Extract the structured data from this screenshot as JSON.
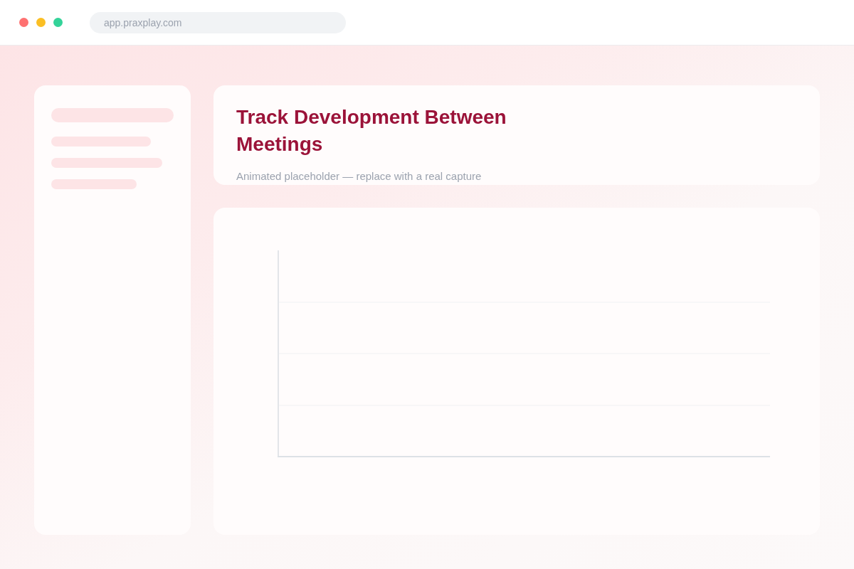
{
  "browser_bar": {
    "url": "app.praxplay.com"
  },
  "header": {
    "title": "Track Development Between Meetings",
    "subtitle": "Animated placeholder — replace with a real capture"
  }
}
